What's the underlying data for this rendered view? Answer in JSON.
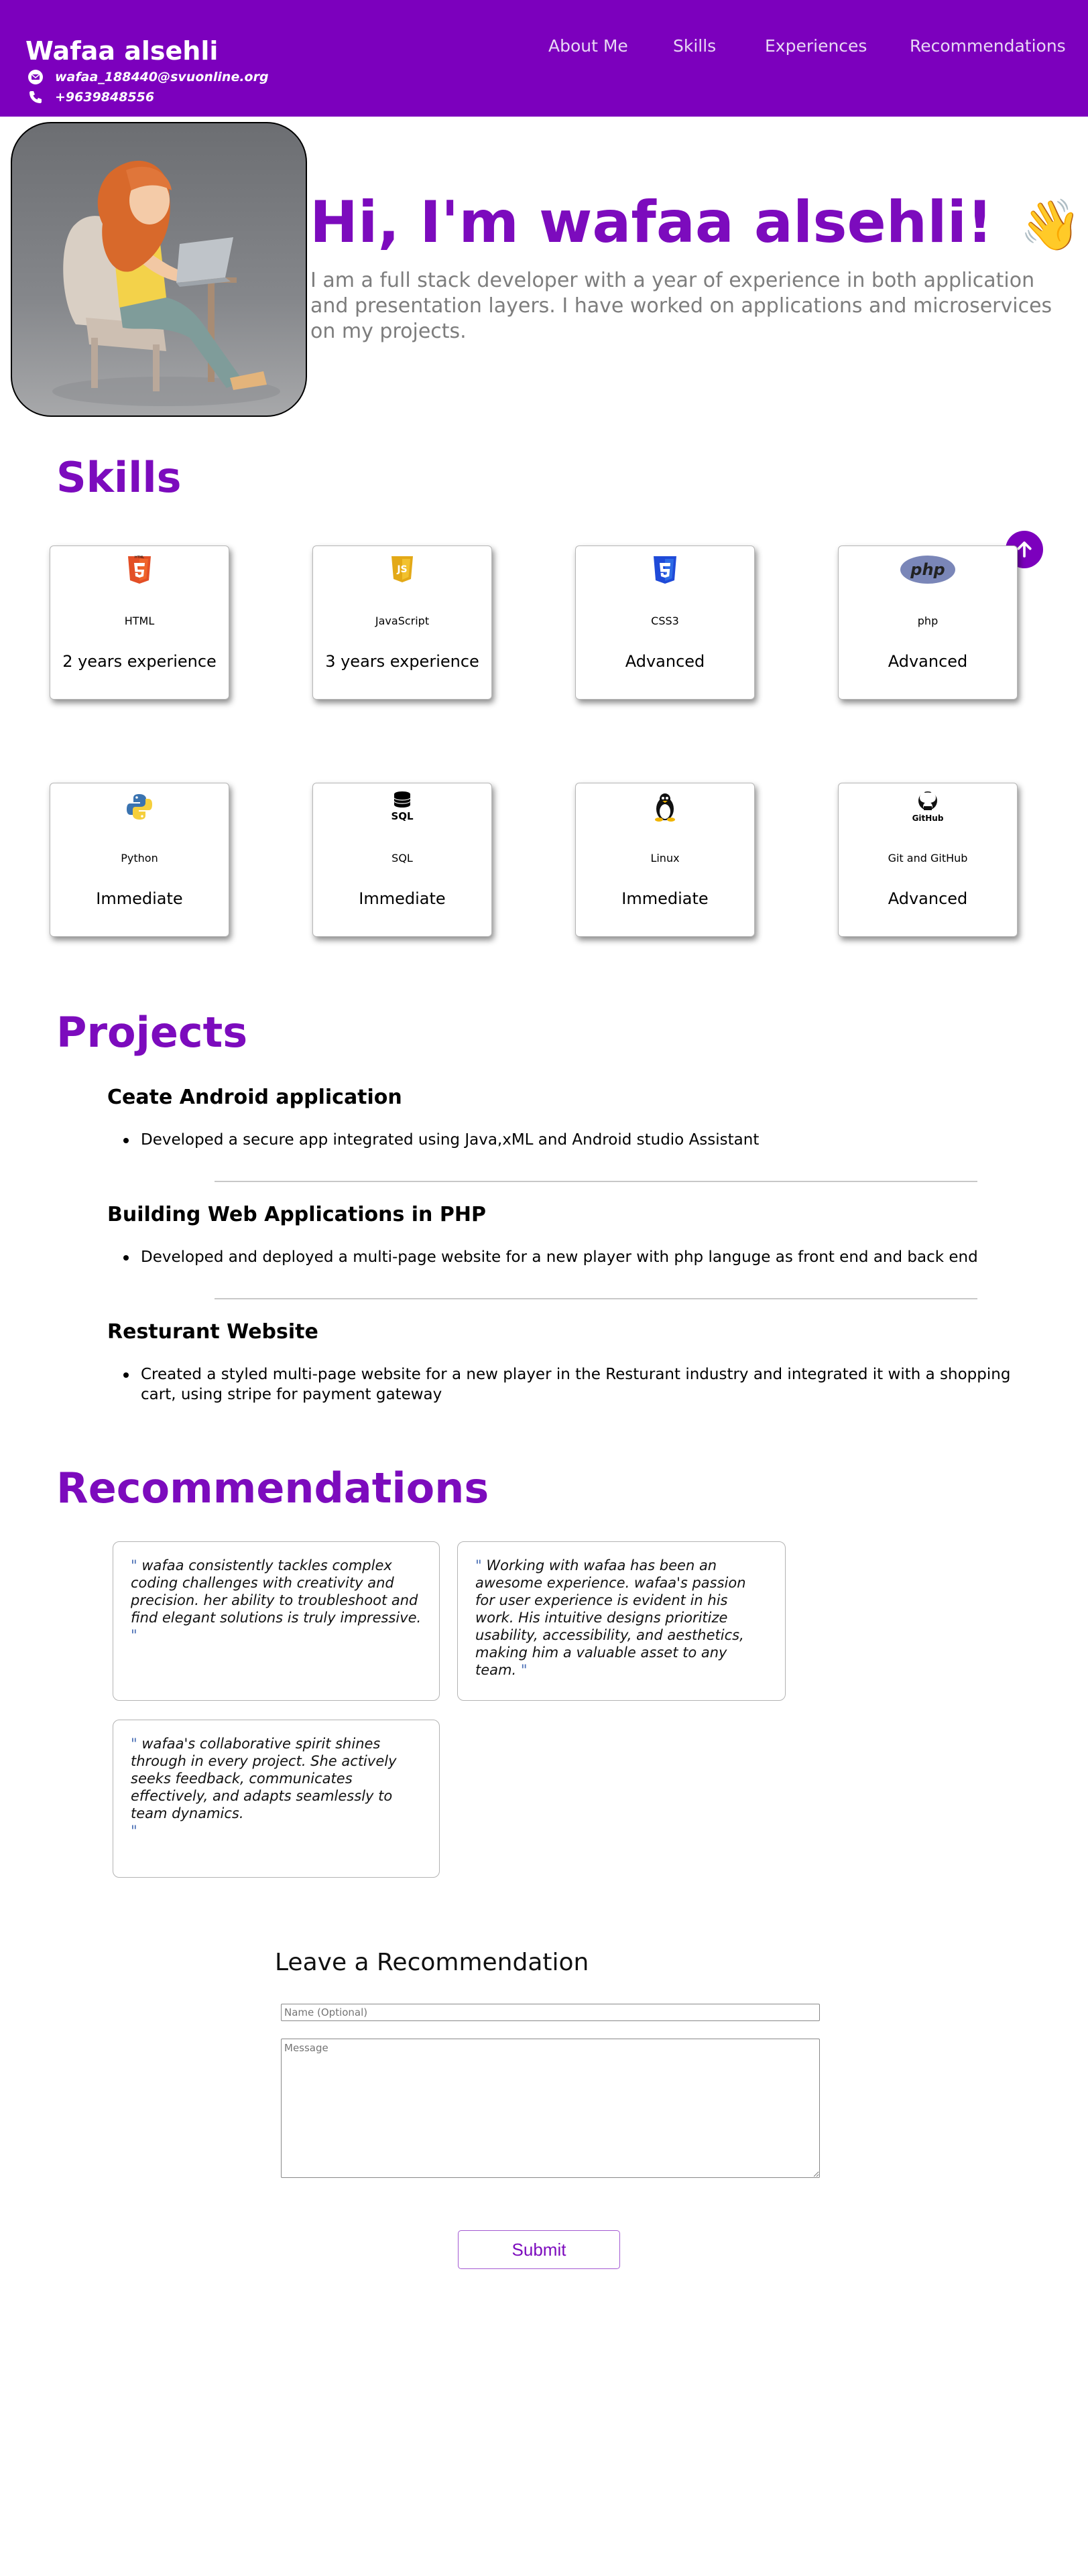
{
  "header": {
    "brand": "Wafaa alsehli",
    "email": "wafaa_188440@svuonline.org",
    "phone": "+9639848556",
    "nav": [
      "About Me",
      "Skills",
      "Experiences",
      "Recommendations"
    ]
  },
  "hero": {
    "title": "Hi, I'm wafaa alsehli!",
    "wave_emoji": "👋",
    "description": "I am a full stack developer with a year of experience in both application and presentation layers. I have worked on applications and microservices on my projects."
  },
  "skills": {
    "title": "Skills",
    "items": [
      {
        "name": "HTML",
        "level": "2 years experience",
        "icon": "html5-icon"
      },
      {
        "name": "JavaScript",
        "level": "3 years experience",
        "icon": "javascript-icon"
      },
      {
        "name": "CSS3",
        "level": "Advanced",
        "icon": "css3-icon"
      },
      {
        "name": "php",
        "level": "Advanced",
        "icon": "php-icon"
      },
      {
        "name": "Python",
        "level": "Immediate",
        "icon": "python-icon"
      },
      {
        "name": "SQL",
        "level": "Immediate",
        "icon": "sql-icon"
      },
      {
        "name": "Linux",
        "level": "Immediate",
        "icon": "linux-icon"
      },
      {
        "name": "Git and GitHub",
        "level": "Advanced",
        "icon": "github-icon"
      }
    ],
    "logo_text": {
      "html": "HTML",
      "sql": "SQL",
      "github": "GitHub",
      "php": "php"
    }
  },
  "projects": {
    "title": "Projects",
    "items": [
      {
        "title": "Ceate Android application",
        "bullet": "Developed a secure app integrated using Java,xML and Android studio Assistant"
      },
      {
        "title": "Building Web Applications in PHP",
        "bullet": "Developed and deployed a multi-page website for a new player with php languge as front end and back end"
      },
      {
        "title": "Resturant Website",
        "bullet": "Created a styled multi-page website for a new player in the Resturant industry and integrated it with a shopping cart, using stripe for payment gateway"
      }
    ]
  },
  "recommendations": {
    "title": "Recommendations",
    "open_quote": "\"",
    "close_quote": "\"",
    "items": [
      "wafaa consistently tackles complex coding challenges with creativity and precision. her ability to troubleshoot and find elegant solutions is truly impressive.",
      "Working with wafaa has been an awesome experience. wafaa's passion for user experience is evident in his work. His intuitive designs prioritize usability, accessibility, and aesthetics, making him a valuable asset to any team.",
      "wafaa's collaborative spirit shines through in every project. She actively seeks feedback, communicates effectively, and adapts seamlessly to team dynamics."
    ]
  },
  "form": {
    "title": "Leave a Recommendation",
    "name_placeholder": "Name (Optional)",
    "message_placeholder": "Message",
    "submit_label": "Submit"
  },
  "colors": {
    "brand_purple": "#7c00bd",
    "heading_purple": "#7c0bbd",
    "description_gray": "#7d7d7d"
  }
}
